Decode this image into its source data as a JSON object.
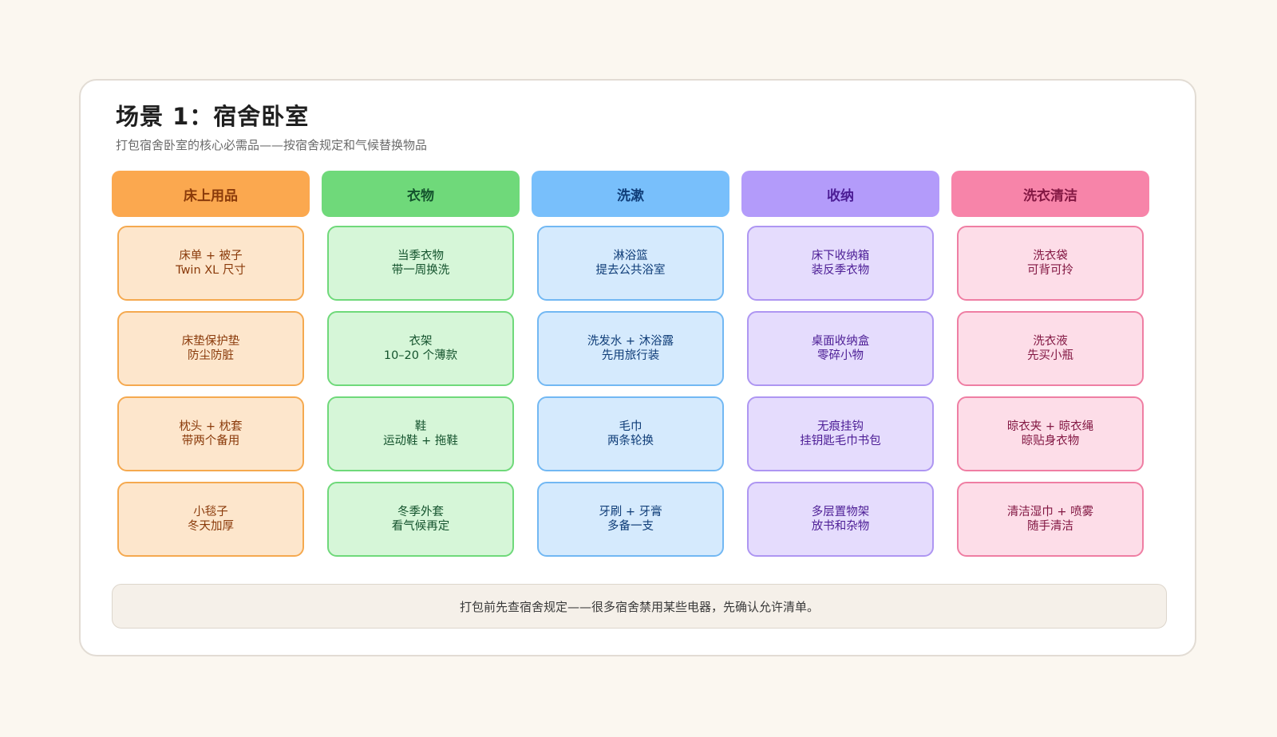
{
  "title": "场景 1：宿舍卧室",
  "subtitle": "打包宿舍卧室的核心必需品——按宿舍规定和气候替换物品",
  "columns": [
    {
      "header": "床上用品",
      "colors": {
        "header_bg": "#fba84f",
        "header_text": "#8a3a0a",
        "card_bg": "#fde6cc",
        "card_border": "#f5a94f",
        "card_text": "#8a3a0a"
      },
      "items": [
        {
          "line1": "床单 + 被子",
          "line2": "Twin XL 尺寸"
        },
        {
          "line1": "床垫保护垫",
          "line2": "防尘防脏"
        },
        {
          "line1": "枕头 + 枕套",
          "line2": "带两个备用"
        },
        {
          "line1": "小毯子",
          "line2": "冬天加厚"
        }
      ]
    },
    {
      "header": "衣物",
      "colors": {
        "header_bg": "#6fd97a",
        "header_text": "#14532d",
        "card_bg": "#d6f6d8",
        "card_border": "#6fd97a",
        "card_text": "#14532d"
      },
      "items": [
        {
          "line1": "当季衣物",
          "line2": "带一周换洗"
        },
        {
          "line1": "衣架",
          "line2": "10–20 个薄款"
        },
        {
          "line1": "鞋",
          "line2": "运动鞋 + 拖鞋"
        },
        {
          "line1": "冬季外套",
          "line2": "看气候再定"
        }
      ]
    },
    {
      "header": "洗漱",
      "colors": {
        "header_bg": "#78bffb",
        "header_text": "#0f3d78",
        "card_bg": "#d5eafd",
        "card_border": "#72b8f3",
        "card_text": "#0f3d78"
      },
      "items": [
        {
          "line1": "淋浴篮",
          "line2": "提去公共浴室"
        },
        {
          "line1": "洗发水 + 沐浴露",
          "line2": "先用旅行装"
        },
        {
          "line1": "毛巾",
          "line2": "两条轮换"
        },
        {
          "line1": "牙刷 + 牙膏",
          "line2": "多备一支"
        }
      ]
    },
    {
      "header": "收纳",
      "colors": {
        "header_bg": "#b39bfa",
        "header_text": "#4c1d95",
        "card_bg": "#e5dcfd",
        "card_border": "#ae96f2",
        "card_text": "#4c1d95"
      },
      "items": [
        {
          "line1": "床下收纳箱",
          "line2": "装反季衣物"
        },
        {
          "line1": "桌面收纳盒",
          "line2": "零碎小物"
        },
        {
          "line1": "无痕挂钩",
          "line2": "挂钥匙毛巾书包"
        },
        {
          "line1": "多层置物架",
          "line2": "放书和杂物"
        }
      ]
    },
    {
      "header": "洗衣清洁",
      "colors": {
        "header_bg": "#f784a9",
        "header_text": "#831843",
        "card_bg": "#fddde8",
        "card_border": "#ef7ea3",
        "card_text": "#831843"
      },
      "items": [
        {
          "line1": "洗衣袋",
          "line2": "可背可拎"
        },
        {
          "line1": "洗衣液",
          "line2": "先买小瓶"
        },
        {
          "line1": "晾衣夹 + 晾衣绳",
          "line2": "晾贴身衣物"
        },
        {
          "line1": "清洁湿巾 + 喷雾",
          "line2": "随手清洁"
        }
      ]
    }
  ],
  "footer": "打包前先查宿舍规定——很多宿舍禁用某些电器，先确认允许清单。"
}
